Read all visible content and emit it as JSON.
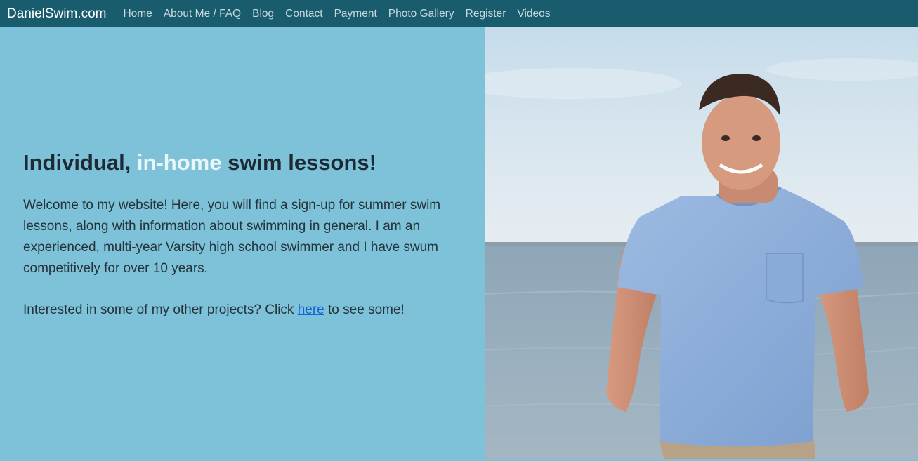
{
  "navbar": {
    "brand": "DanielSwim.com",
    "items": [
      {
        "label": "Home"
      },
      {
        "label": "About Me / FAQ"
      },
      {
        "label": "Blog"
      },
      {
        "label": "Contact"
      },
      {
        "label": "Payment"
      },
      {
        "label": "Photo Gallery"
      },
      {
        "label": "Register"
      },
      {
        "label": "Videos"
      }
    ]
  },
  "hero": {
    "heading_part1": "Individual, ",
    "heading_highlight": "in-home",
    "heading_part2": " swim lessons!",
    "intro": "Welcome to my website! Here, you will find a sign-up for summer swim lessons, along with information about swimming in general. I am an experienced, multi-year Varsity high school swimmer and I have swum competitively for over 10 years.",
    "projects_prefix": "Interested in some of my other projects? Click ",
    "projects_link": "here",
    "projects_suffix": " to see some!"
  },
  "colors": {
    "navbar_bg": "#195c6e",
    "page_bg": "#7dc2d9",
    "highlight": "#eaf6fa",
    "link": "#1466d6"
  }
}
